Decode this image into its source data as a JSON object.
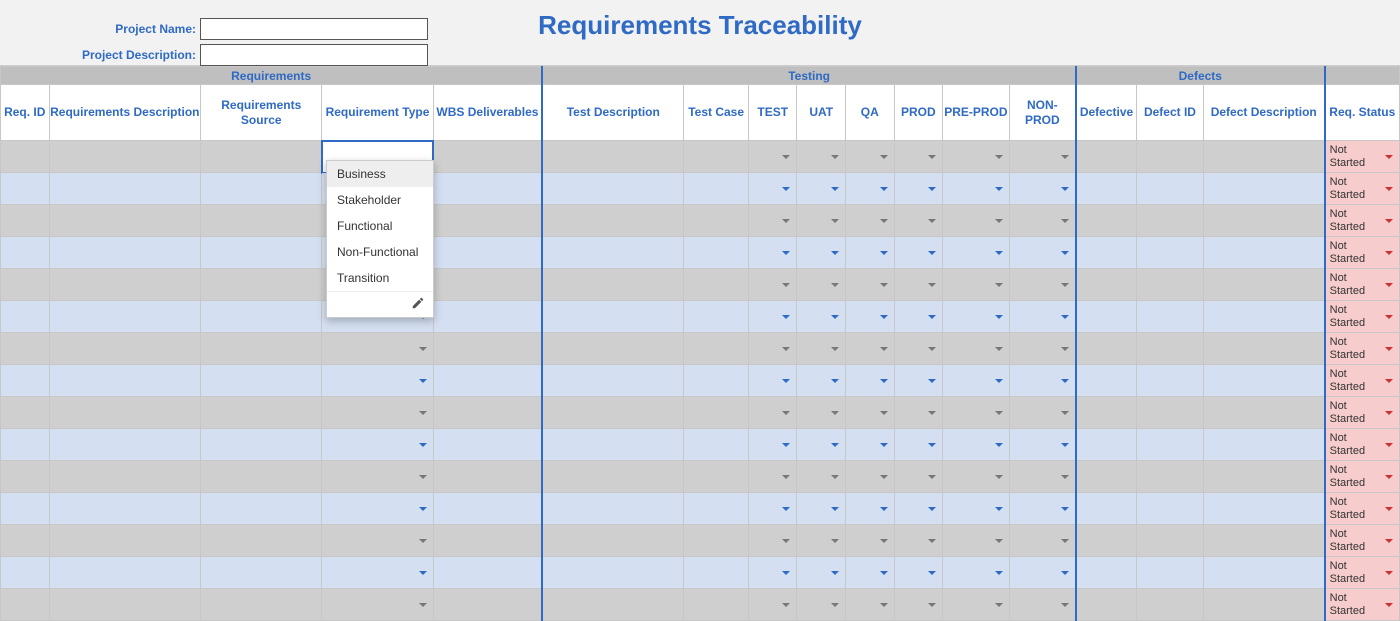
{
  "header": {
    "title": "Requirements Traceability",
    "project_name_label": "Project Name:",
    "project_desc_label": "Project Description:",
    "project_name_value": "",
    "project_desc_value": ""
  },
  "groups": {
    "requirements": "Requirements",
    "testing": "Testing",
    "defects": "Defects"
  },
  "columns": {
    "req_id": "Req. ID",
    "req_desc": "Requirements Description",
    "req_src": "Requirements Source",
    "req_type": "Requirement Type",
    "wbs": "WBS Deliverables",
    "test_desc": "Test Description",
    "test_case": "Test Case",
    "test": "TEST",
    "uat": "UAT",
    "qa": "QA",
    "prod": "PROD",
    "preprod": "PRE-PROD",
    "nonprod": "NON-PROD",
    "defective": "Defective",
    "defect_id": "Defect ID",
    "defect_desc": "Defect Description",
    "status": "Req. Status"
  },
  "dropdown": {
    "options": [
      "Business",
      "Stakeholder",
      "Functional",
      "Non-Functional",
      "Transition"
    ]
  },
  "status_value": "Not Started",
  "row_count": 15
}
